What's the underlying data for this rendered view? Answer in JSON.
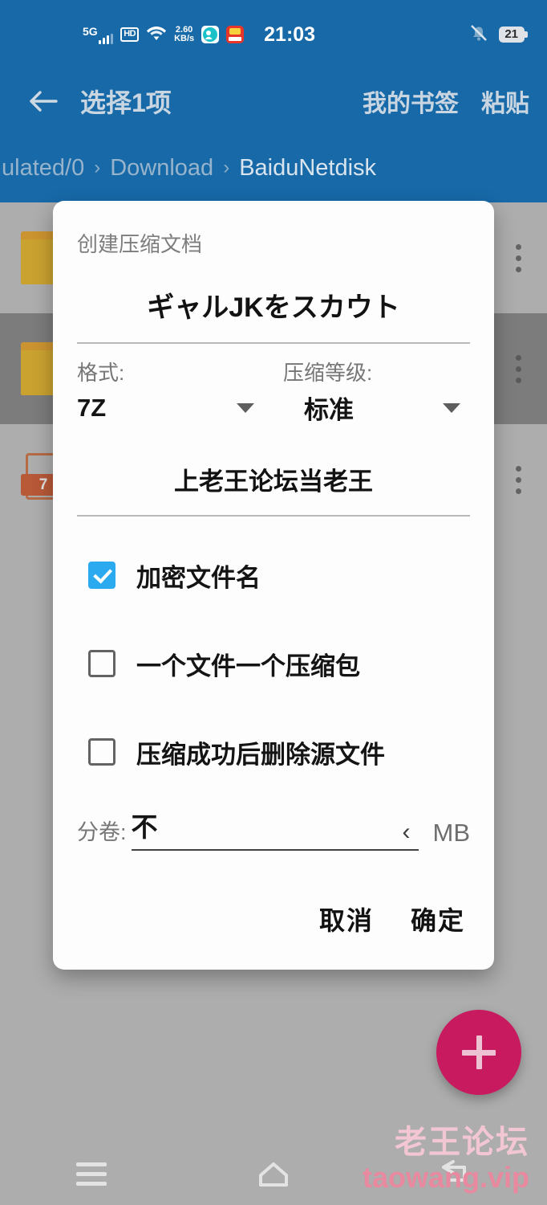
{
  "status_bar": {
    "network_label": "5G",
    "hd_label": "HD",
    "speed_value": "2.60",
    "speed_unit": "KB/s",
    "clock": "21:03",
    "battery_level": "21",
    "icons": [
      "signal-bars-icon",
      "hd-icon",
      "wifi-icon",
      "data-speed-icon",
      "app-icon-teal",
      "app-icon-red",
      "mute-bell-icon",
      "battery-icon"
    ]
  },
  "app_bar": {
    "back_label": "←",
    "title": "选择1项",
    "actions": [
      {
        "label": "我的书签"
      },
      {
        "label": "粘贴"
      }
    ]
  },
  "breadcrumb": {
    "separator": "›",
    "items": [
      {
        "label": "ulated/0"
      },
      {
        "label": "Download"
      },
      {
        "label": "BaiduNetdisk"
      }
    ]
  },
  "file_list": {
    "rows": [
      {
        "icon": "folder-icon",
        "name": "",
        "sub": "",
        "selected": false
      },
      {
        "icon": "folder-icon",
        "name": "",
        "sub": "",
        "selected": true
      },
      {
        "icon": "sevenz-file-icon",
        "icon_text": "7",
        "name": "",
        "sub": "",
        "selected": false
      }
    ]
  },
  "dialog": {
    "title": "创建压缩文档",
    "filename": "ギャルJKをスカウト",
    "format": {
      "label": "格式:",
      "value": "7Z"
    },
    "level": {
      "label": "压缩等级:",
      "value": "标准"
    },
    "password": "上老王论坛当老王",
    "checkboxes": [
      {
        "label": "加密文件名",
        "checked": true
      },
      {
        "label": "一个文件一个压缩包",
        "checked": false
      },
      {
        "label": "压缩成功后删除源文件",
        "checked": false
      }
    ],
    "split": {
      "label": "分卷:",
      "value": "不",
      "chevron": "‹",
      "unit": "MB"
    },
    "buttons": {
      "cancel": "取消",
      "confirm": "确定"
    }
  },
  "fab": {
    "icon": "plus-icon",
    "color": "#c81a5e"
  },
  "watermark": {
    "line1": "老王论坛",
    "line2": "taowang.vip"
  },
  "nav_bar": {
    "items": [
      {
        "icon": "recents-menu-icon"
      },
      {
        "icon": "home-icon"
      },
      {
        "icon": "back-icon"
      }
    ]
  },
  "colors": {
    "app_bar": "#1769a8",
    "background": "#b3b3b3",
    "selected_row": "#6e6e6e",
    "checkbox_on": "#2caaf0",
    "fab": "#c81a5e",
    "watermark": "#e8899f"
  }
}
